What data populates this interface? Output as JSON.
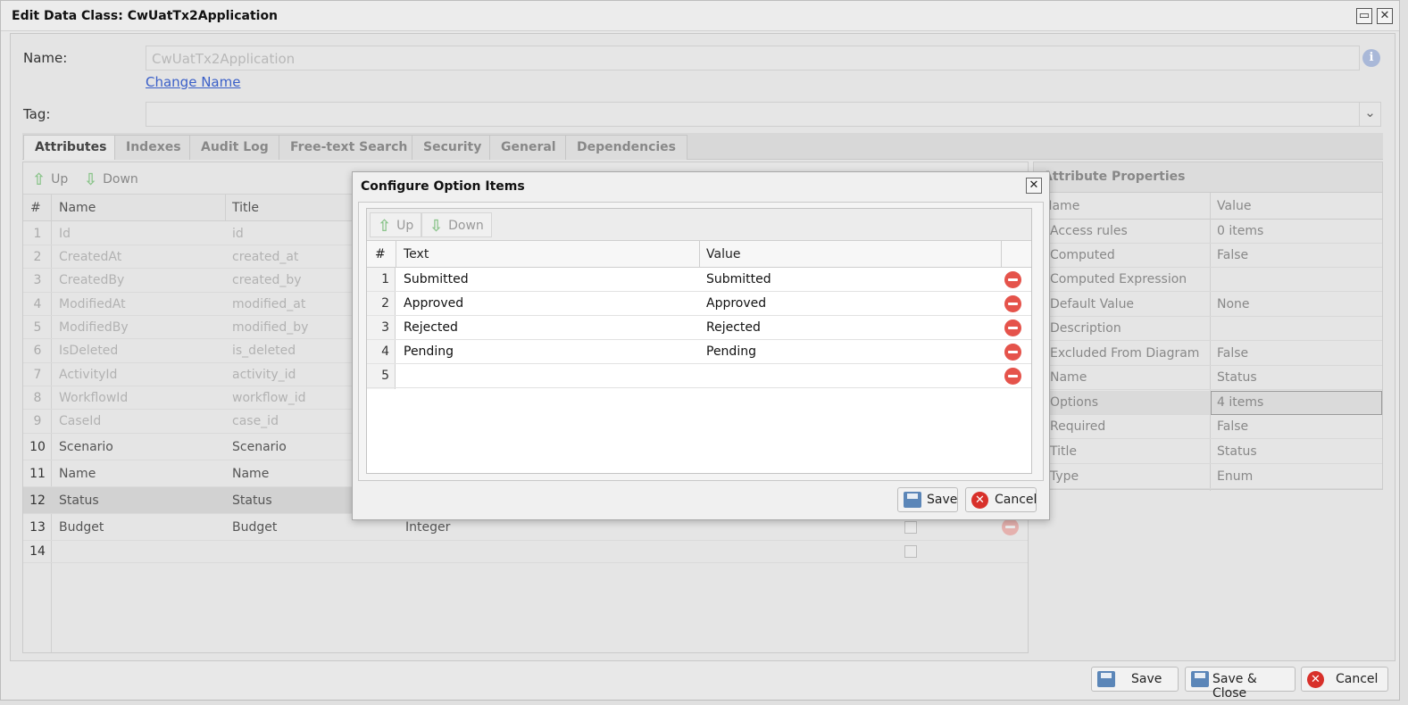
{
  "window": {
    "title": "Edit Data Class: CwUatTx2Application",
    "maximize_glyph": "▭",
    "close_glyph": "✕"
  },
  "form": {
    "name_label": "Name:",
    "name_value": "CwUatTx2Application",
    "change_name_link": "Change Name",
    "info_glyph": "i",
    "tag_label": "Tag:",
    "tag_value": "",
    "tag_dropdown_glyph": "⌄"
  },
  "tabs": [
    "Attributes",
    "Indexes",
    "Audit Log",
    "Free-text Search",
    "Security",
    "General",
    "Dependencies"
  ],
  "attributes": {
    "toolbar": {
      "up_label": "Up",
      "down_label": "Down",
      "up_glyph": "⇧",
      "down_glyph": "⇩"
    },
    "columns": {
      "num": "#",
      "name": "Name",
      "title": "Title"
    },
    "rows": [
      {
        "num": "1",
        "name": "Id",
        "title": "id",
        "type": ""
      },
      {
        "num": "2",
        "name": "CreatedAt",
        "title": "created_at",
        "type": ""
      },
      {
        "num": "3",
        "name": "CreatedBy",
        "title": "created_by",
        "type": ""
      },
      {
        "num": "4",
        "name": "ModifiedAt",
        "title": "modified_at",
        "type": ""
      },
      {
        "num": "5",
        "name": "ModifiedBy",
        "title": "modified_by",
        "type": ""
      },
      {
        "num": "6",
        "name": "IsDeleted",
        "title": "is_deleted",
        "type": ""
      },
      {
        "num": "7",
        "name": "ActivityId",
        "title": "activity_id",
        "type": ""
      },
      {
        "num": "8",
        "name": "WorkflowId",
        "title": "workflow_id",
        "type": ""
      },
      {
        "num": "9",
        "name": "CaseId",
        "title": "case_id",
        "type": ""
      },
      {
        "num": "10",
        "name": "Scenario",
        "title": "Scenario",
        "type": ""
      },
      {
        "num": "11",
        "name": "Name",
        "title": "Name",
        "type": ""
      },
      {
        "num": "12",
        "name": "Status",
        "title": "Status",
        "type": ""
      },
      {
        "num": "13",
        "name": "Budget",
        "title": "Budget",
        "type": "Integer"
      },
      {
        "num": "14",
        "name": "",
        "title": "",
        "type": ""
      }
    ]
  },
  "properties": {
    "header": "Attribute Properties",
    "col_name": "Name",
    "col_value": "Value",
    "rows": [
      {
        "name": "Access rules",
        "value": "0 items"
      },
      {
        "name": "Computed",
        "value": "False"
      },
      {
        "name": "Computed Expression",
        "value": ""
      },
      {
        "name": "Default Value",
        "value": "None"
      },
      {
        "name": "Description",
        "value": ""
      },
      {
        "name": "Excluded From Diagram",
        "value": "False"
      },
      {
        "name": "Name",
        "value": "Status"
      },
      {
        "name": "Options",
        "value": "4 items"
      },
      {
        "name": "Required",
        "value": "False"
      },
      {
        "name": "Title",
        "value": "Status"
      },
      {
        "name": "Type",
        "value": "Enum"
      }
    ]
  },
  "footer": {
    "save_label": "Save",
    "save_close_label": "Save & Close",
    "cancel_label": "Cancel",
    "cancel_glyph": "✕"
  },
  "dialog": {
    "title": "Configure Option Items",
    "close_glyph": "✕",
    "toolbar": {
      "up_label": "Up",
      "down_label": "Down",
      "up_glyph": "⇧",
      "down_glyph": "⇩"
    },
    "columns": {
      "num": "#",
      "text": "Text",
      "value": "Value"
    },
    "rows": [
      {
        "num": "1",
        "text": "Submitted",
        "value": "Submitted"
      },
      {
        "num": "2",
        "text": "Approved",
        "value": "Approved"
      },
      {
        "num": "3",
        "text": "Rejected",
        "value": "Rejected"
      },
      {
        "num": "4",
        "text": "Pending",
        "value": "Pending"
      },
      {
        "num": "5",
        "text": "",
        "value": ""
      }
    ],
    "save_label": "Save",
    "cancel_label": "Cancel",
    "cancel_glyph": "✕"
  }
}
